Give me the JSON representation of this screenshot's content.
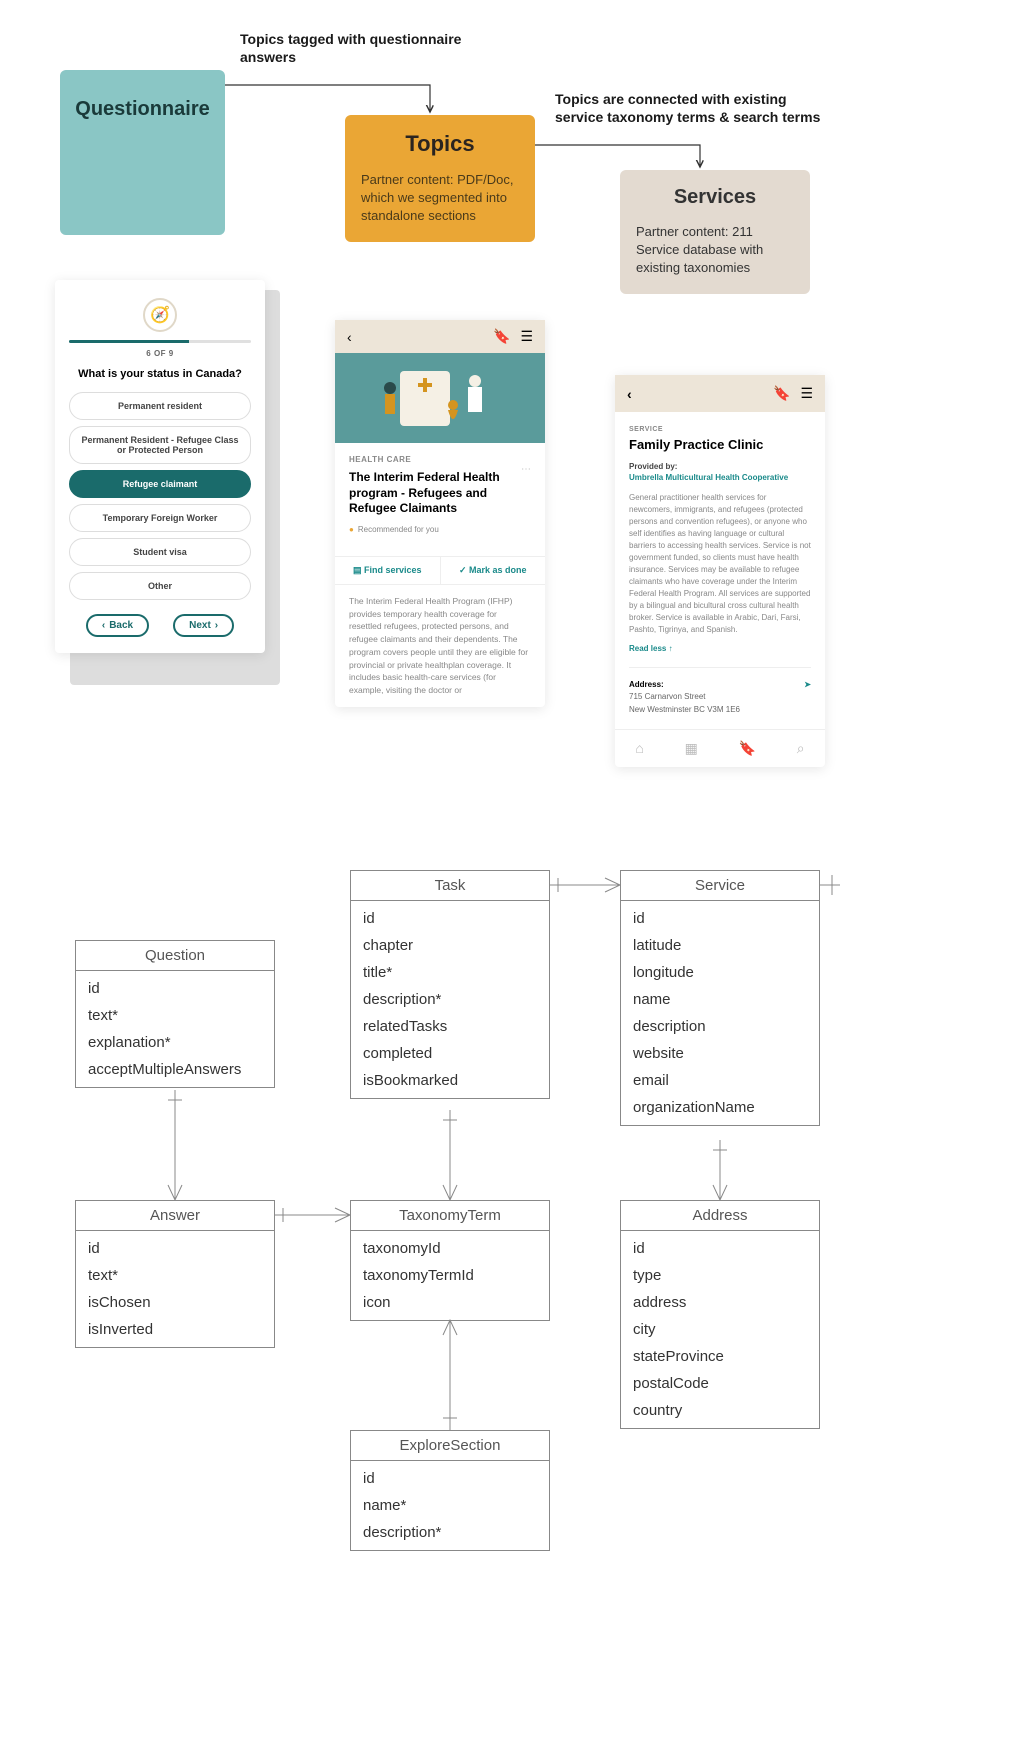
{
  "annotations": {
    "a1": "Topics tagged with questionnaire answers",
    "a2": "Topics are connected with existing service taxonomy terms & search terms"
  },
  "flow": {
    "questionnaire": {
      "title": "Questionnaire"
    },
    "topics": {
      "title": "Topics",
      "desc": "Partner content: PDF/Doc, which we segmented into standalone sections"
    },
    "services": {
      "title": "Services",
      "desc": "Partner content: 211 Service database with existing taxonomies"
    }
  },
  "questionnaire_phone": {
    "step": "6 OF 9",
    "question": "What is your status in Canada?",
    "options": [
      "Permanent resident",
      "Permanent Resident - Refugee Class or Protected Person",
      "Refugee claimant",
      "Temporary Foreign Worker",
      "Student visa",
      "Other"
    ],
    "selected_index": 2,
    "back": "Back",
    "next": "Next"
  },
  "topic_phone": {
    "category": "HEALTH CARE",
    "title": "The Interim Federal Health program - Refugees and Refugee Claimants",
    "recommended": "Recommended for you",
    "find": "Find services",
    "mark": "Mark as done",
    "body": "The Interim Federal Health Program (IFHP) provides temporary health coverage for resettled refugees, protected persons, and refugee claimants and their dependents. The program covers people until they are eligible for provincial or private healthplan coverage. It includes basic health-care services (for example, visiting the doctor or"
  },
  "service_phone": {
    "label": "SERVICE",
    "title": "Family Practice Clinic",
    "provided_by": "Provided by:",
    "provider": "Umbrella Multicultural Health Cooperative",
    "desc": "General practitioner health services for newcomers, immigrants, and refugees (protected persons and convention refugees), or anyone who self identifies as having language or cultural barriers to accessing health services. Service is not government funded, so clients must have health insurance. Services may be available to refugee claimants who have coverage under the Interim Federal Health Program. All services are supported by a bilingual and bicultural cross cultural health broker. Service is available in Arabic, Dari, Farsi, Pashto, Tigrinya, and Spanish.",
    "readless": "Read less  ↑",
    "address_label": "Address:",
    "address_line1": "715 Carnarvon Street",
    "address_line2": "New Westminster BC V3M 1E6"
  },
  "er": {
    "question": {
      "title": "Question",
      "fields": [
        "id",
        "text*",
        "explanation*",
        "acceptMultipleAnswers"
      ]
    },
    "task": {
      "title": "Task",
      "fields": [
        "id",
        "chapter",
        "title*",
        "description*",
        "relatedTasks",
        "completed",
        "isBookmarked"
      ]
    },
    "service": {
      "title": "Service",
      "fields": [
        "id",
        "latitude",
        "longitude",
        "name",
        "description",
        "website",
        "email",
        "organizationName"
      ]
    },
    "answer": {
      "title": "Answer",
      "fields": [
        "id",
        "text*",
        "isChosen",
        "isInverted"
      ]
    },
    "taxonomyterm": {
      "title": "TaxonomyTerm",
      "fields": [
        "taxonomyId",
        "taxonomyTermId",
        "icon"
      ]
    },
    "address": {
      "title": "Address",
      "fields": [
        "id",
        "type",
        "address",
        "city",
        "stateProvince",
        "postalCode",
        "country"
      ]
    },
    "exploresection": {
      "title": "ExploreSection",
      "fields": [
        "id",
        "name*",
        "description*"
      ]
    }
  }
}
